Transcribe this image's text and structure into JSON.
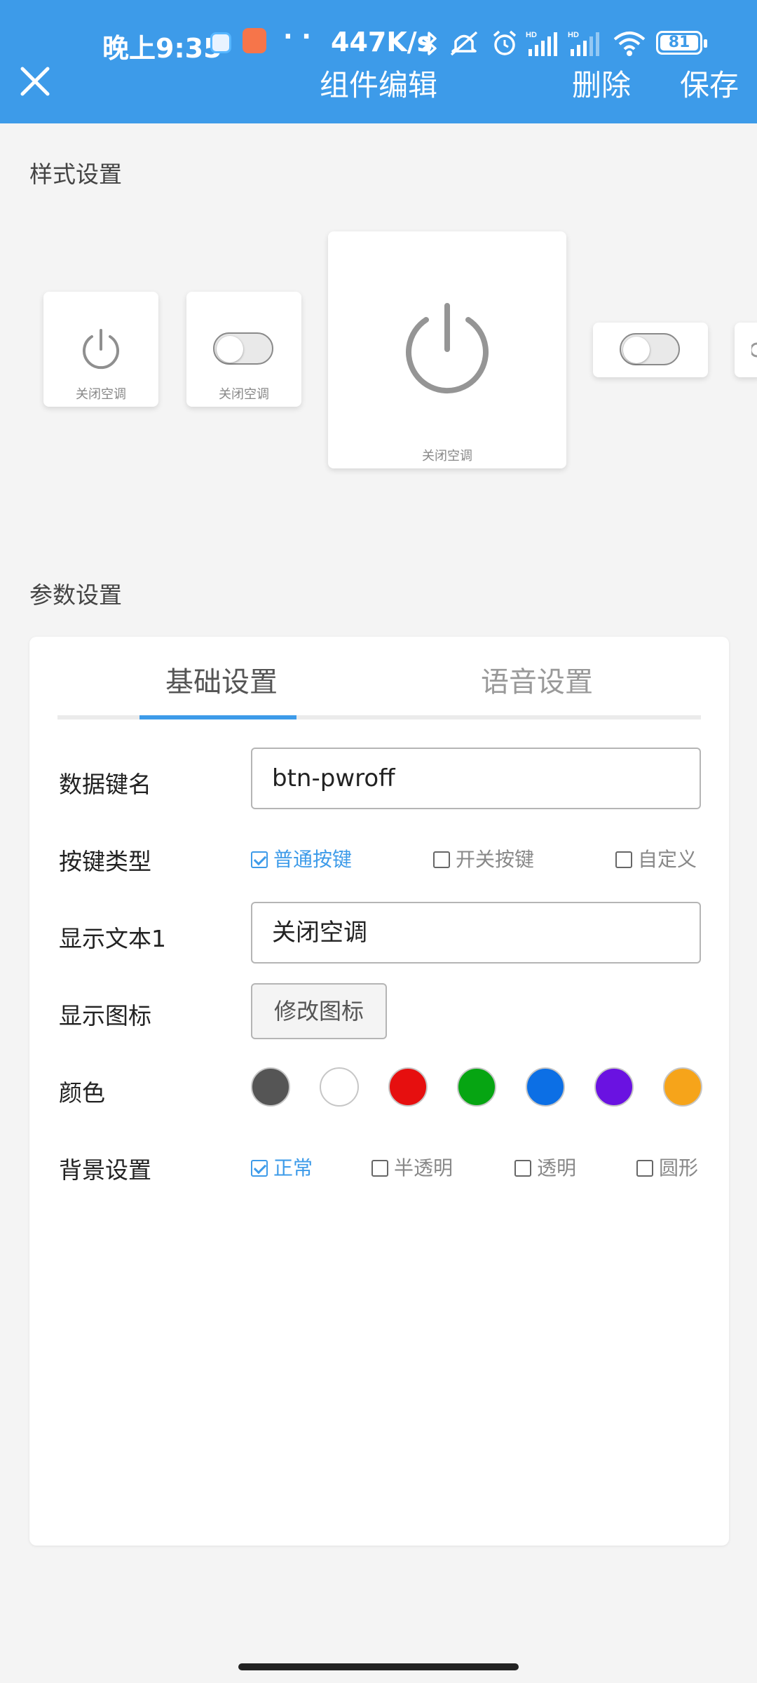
{
  "status_bar": {
    "time": "晚上9:35",
    "dots": "· ·",
    "speed": "447K/s",
    "battery": "81"
  },
  "nav": {
    "title": "组件编辑",
    "delete_label": "删除",
    "save_label": "保存"
  },
  "style_section": {
    "label": "样式设置",
    "cards": [
      {
        "label": "关闭空调",
        "kind": "power-icon"
      },
      {
        "label": "关闭空调",
        "kind": "toggle"
      },
      {
        "label": "关闭空调",
        "kind": "power-icon-large"
      },
      {
        "label": "",
        "kind": "toggle"
      }
    ]
  },
  "param_section": {
    "label": "参数设置",
    "tabs": [
      {
        "label": "基础设置",
        "active": true
      },
      {
        "label": "语音设置",
        "active": false
      }
    ],
    "fields": {
      "data_key": {
        "label": "数据键名",
        "value": "btn-pwroff"
      },
      "button_type": {
        "label": "按键类型",
        "options": [
          {
            "label": "普通按键",
            "checked": true
          },
          {
            "label": "开关按键",
            "checked": false
          },
          {
            "label": "自定义",
            "checked": false
          }
        ]
      },
      "display_text": {
        "label": "显示文本1",
        "value": "关闭空调"
      },
      "display_icon": {
        "label": "显示图标",
        "button_label": "修改图标"
      },
      "color": {
        "label": "颜色",
        "swatches": [
          "#555555",
          "#ffffff",
          "#e60f0f",
          "#06a512",
          "#0c6fe5",
          "#6a12e1",
          "#f6a41a"
        ]
      },
      "background": {
        "label": "背景设置",
        "options": [
          {
            "label": "正常",
            "checked": true
          },
          {
            "label": "半透明",
            "checked": false
          },
          {
            "label": "透明",
            "checked": false
          },
          {
            "label": "圆形",
            "checked": false
          }
        ]
      }
    }
  },
  "colors": {
    "accent": "#3d9be9",
    "background": "#f4f4f4"
  }
}
